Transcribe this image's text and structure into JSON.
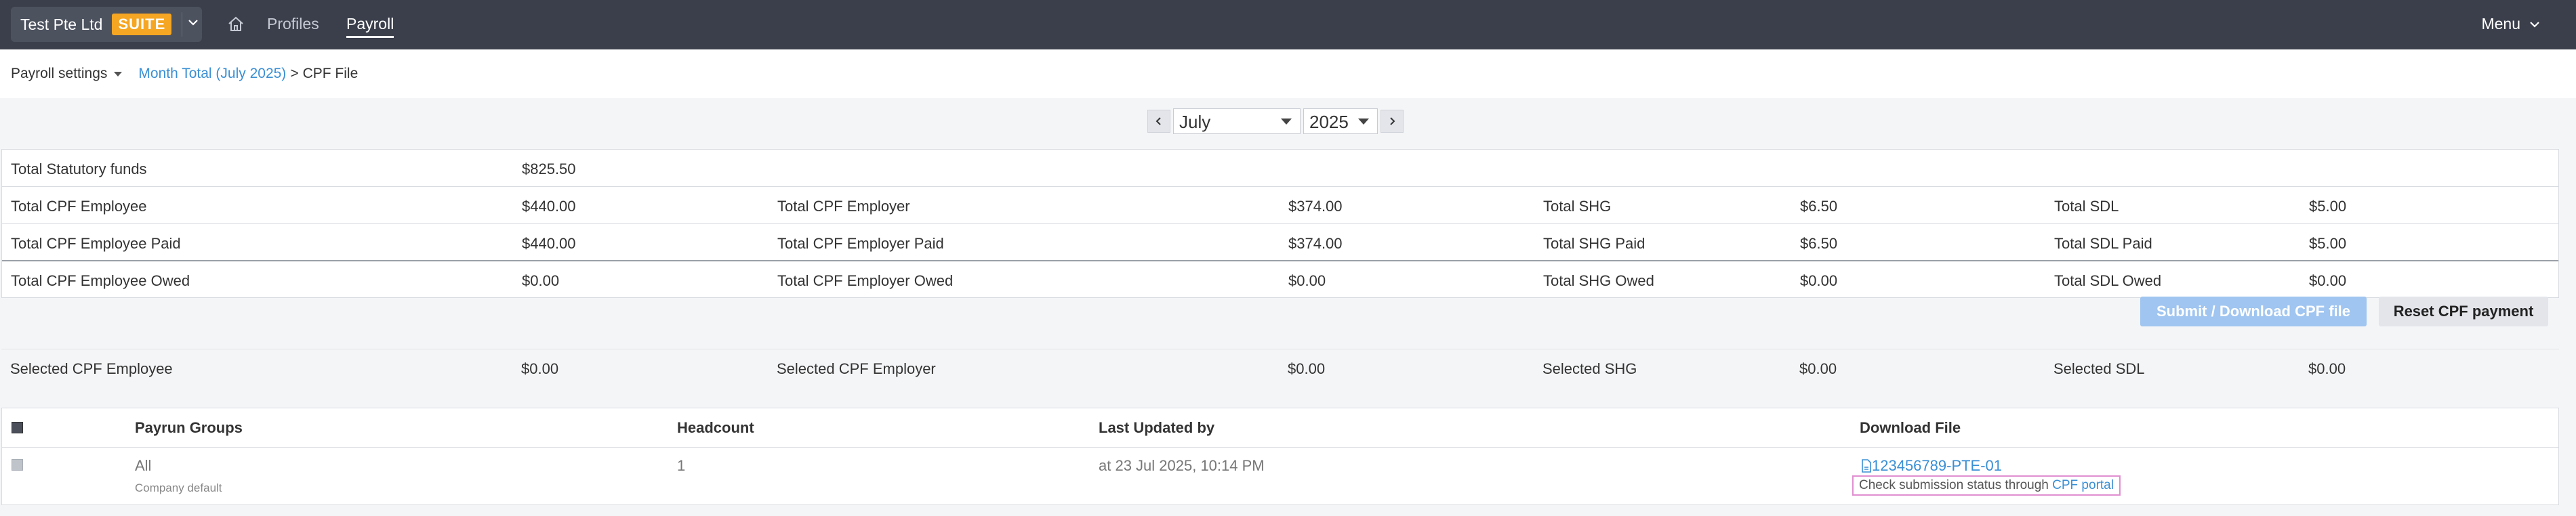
{
  "header": {
    "company_name": "Test Pte Ltd",
    "suite_badge": "SUITE",
    "nav": {
      "profiles": "Profiles",
      "payroll": "Payroll"
    },
    "menu_label": "Menu"
  },
  "breadcrumb": {
    "settings": "Payroll settings",
    "month_total": "Month Total (July 2025)",
    "separator": ">",
    "current": "CPF File"
  },
  "period": {
    "month": "July",
    "year": "2025"
  },
  "totals": {
    "statutory_label": "Total Statutory funds",
    "statutory_value": "$825.50",
    "rows": [
      [
        "Total CPF Employee",
        "$440.00",
        "Total CPF Employer",
        "$374.00",
        "Total SHG",
        "$6.50",
        "Total SDL",
        "$5.00"
      ],
      [
        "Total CPF Employee Paid",
        "$440.00",
        "Total CPF Employer Paid",
        "$374.00",
        "Total SHG Paid",
        "$6.50",
        "Total SDL Paid",
        "$5.00"
      ],
      [
        "Total CPF Employee Owed",
        "$0.00",
        "Total CPF Employer Owed",
        "$0.00",
        "Total SHG Owed",
        "$0.00",
        "Total SDL Owed",
        "$0.00"
      ]
    ]
  },
  "actions": {
    "submit": "Submit / Download CPF file",
    "reset": "Reset CPF payment"
  },
  "selected": [
    "Selected CPF Employee",
    "$0.00",
    "Selected CPF Employer",
    "$0.00",
    "Selected SHG",
    "$0.00",
    "Selected SDL",
    "$0.00"
  ],
  "payrun_table": {
    "headers": {
      "groups": "Payrun Groups",
      "headcount": "Headcount",
      "updated": "Last Updated by",
      "download": "Download File"
    },
    "row": {
      "group": "All",
      "group_sub": "Company default",
      "headcount": "1",
      "updated": "at 23 Jul 2025, 10:14 PM",
      "file": "123456789-PTE-01",
      "notice_text": "Check submission status through",
      "notice_link": "CPF portal"
    }
  },
  "colors": {
    "topbar": "#3b3f4c",
    "accent": "#3a8fd4",
    "badge": "#f5a623",
    "submit_disabled": "#9fc5f0"
  }
}
